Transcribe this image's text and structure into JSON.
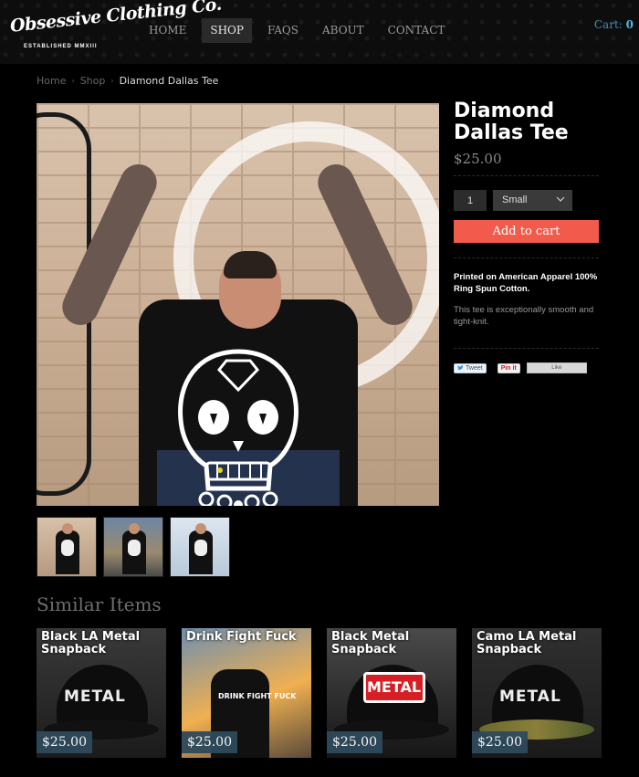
{
  "header": {
    "logo_text": "Obsessive Clothing Co.",
    "logo_tagline": "ESTABLISHED MMXIII",
    "nav": [
      {
        "label": "HOME",
        "active": false
      },
      {
        "label": "SHOP",
        "active": true
      },
      {
        "label": "FAQS",
        "active": false
      },
      {
        "label": "ABOUT",
        "active": false
      },
      {
        "label": "CONTACT",
        "active": false
      }
    ],
    "cart_label": "Cart:",
    "cart_count": "0"
  },
  "breadcrumb": {
    "home": "Home",
    "shop": "Shop",
    "current": "Diamond Dallas Tee"
  },
  "product": {
    "title": "Diamond Dallas Tee",
    "price": "$25.00",
    "quantity": "1",
    "size_selected": "Small",
    "add_to_cart_label": "Add to cart",
    "description_bold": "Printed on American Apparel 100% Ring Spun Cotton.",
    "description": "This tee is exceptionally smooth and tight-knit.",
    "social": {
      "tweet_label": "Tweet",
      "pin_label": "Pin it",
      "like_label": "Like"
    }
  },
  "similar": {
    "heading": "Similar Items",
    "items": [
      {
        "title": "Black LA Metal Snapback",
        "price": "$25.00",
        "cap_text": "METAL"
      },
      {
        "title": "Drink Fight Fuck",
        "price": "$25.00",
        "shirt_text": "DRINK FIGHT FUCK"
      },
      {
        "title": "Black Metal Snapback",
        "price": "$25.00",
        "cap_text": "METAL"
      },
      {
        "title": "Camo LA Metal Snapback",
        "price": "$25.00",
        "cap_text": "METAL"
      }
    ]
  },
  "colors": {
    "background": "#000000",
    "accent_button": "#f25a4b",
    "cart_link": "#3b8fb8",
    "price_tag": "#2e4a5c"
  }
}
